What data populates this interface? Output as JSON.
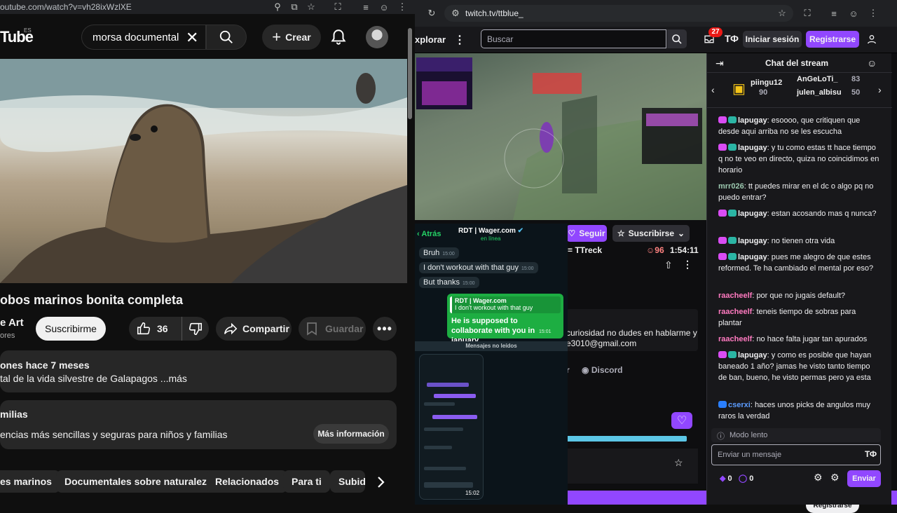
{
  "youtube": {
    "url": "outube.com/watch?v=vh28ixWzlXE",
    "logo": "Tube",
    "logo_region": "ES",
    "search_value": "morsa documental",
    "create_label": "Crear",
    "video_title": "obos marinos bonita completa",
    "channel_name": "e Art",
    "channel_subs": "ores",
    "subscribe_label": "Suscribirme",
    "likes": "36",
    "share_label": "Compartir",
    "save_label": "Guardar",
    "desc_meta": "ones  hace 7 meses",
    "desc_text": "tal de la vida silvestre de Galapagos ...más",
    "info_title": "milias",
    "info_text": "encias más sencillas y seguras para niños y familias",
    "info_more": "Más información",
    "chips": [
      "es marinos",
      "Documentales sobre naturaleza",
      "Relacionados",
      "Para ti",
      "Subid"
    ]
  },
  "twitch": {
    "url": "twitch.tv/ttblue_",
    "explore": "xplorar",
    "search_placeholder": "Buscar",
    "notif_count": "27",
    "login_label": "Iniciar sesión",
    "register_label": "Registrarse",
    "follow_label": "Seguir",
    "subscribe_label": "Suscribirse",
    "streamer_tag": "= TTreck",
    "viewers": "96",
    "uptime": "1:54:11",
    "about_line1": "curiosidad no dudes en hablarme y",
    "about_line2": "e3010@gmail.com",
    "discord_label": "Discord",
    "link_r": "r",
    "register_bottom": "Registrarse"
  },
  "whatsapp": {
    "back": "Atrás",
    "contact": "RDT | Wager.com",
    "status": "en línea",
    "messages": [
      {
        "text": "Bruh",
        "time": "15:00"
      },
      {
        "text": "I don't workout with that guy",
        "time": "15:00"
      },
      {
        "text": "But thanks",
        "time": "15:00"
      }
    ],
    "quote_author": "RDT | Wager.com",
    "quote_text": "I don't workout with that guy",
    "reply_text": "He is supposed to collaborate with you in january",
    "reply_time": "15:01",
    "unread_label": "Mensajes no leídos",
    "shot_time": "15:02"
  },
  "chat": {
    "title": "Chat del stream",
    "gifters": [
      {
        "name": "piingu12",
        "count": "90"
      },
      {
        "name": "AnGeLoTi_",
        "count": "83"
      },
      {
        "name": "julen_albisu",
        "count": "50"
      }
    ],
    "messages": [
      {
        "user": "lapugay",
        "text": "esoooo, que critiquen que desde aqui arriba no se les escucha",
        "color": "#d94cf3",
        "badges": true
      },
      {
        "user": "lapugay",
        "text": "y tu como estas tt hace tiempo q no te veo en directo, quiza no coincidimos en horario",
        "color": "#d94cf3",
        "badges": true
      },
      {
        "user": "mrr026",
        "text": "tt puedes mirar en el dc o algo pq no puedo entrar?",
        "color": "#9cc9b0",
        "badges": false
      },
      {
        "user": "lapugay",
        "text": "estan acosando mas q nunca?",
        "color": "#d94cf3",
        "badges": true
      },
      {
        "user": "lapugay",
        "text": "no tienen otra vida",
        "color": "#d94cf3",
        "badges": true
      },
      {
        "user": "lapugay",
        "text": "pues me alegro de que estes reformed. Te ha cambiado el mental por eso?",
        "color": "#d94cf3",
        "badges": true
      },
      {
        "user": "raacheelf",
        "text": "por que no jugais default?",
        "color": "#ff7ac0",
        "badges": false
      },
      {
        "user": "raacheelf",
        "text": "teneis tiempo de sobras para plantar",
        "color": "#ff7ac0",
        "badges": false
      },
      {
        "user": "raacheelf",
        "text": "no hace falta jugar tan apurados",
        "color": "#ff7ac0",
        "badges": false
      },
      {
        "user": "lapugay",
        "text": "y como es posible que hayan baneado 1 año? jamas he visto tanto tiempo de ban, bueno, he visto permas pero ya esta",
        "color": "#d94cf3",
        "badges": true
      },
      {
        "user": "cserxi",
        "text": "haces unos picks de angulos muy raros la verdad",
        "color": "#5c9cff",
        "badges": false
      }
    ],
    "slow_mode": "Modo lento",
    "input_placeholder": "Enviar un mensaje",
    "points_1": "0",
    "points_2": "0",
    "send_label": "Enviar"
  },
  "colors": {
    "twitch_purple": "#9147ff",
    "whatsapp_green": "#1dae42",
    "youtube_bg": "#0f0f0f"
  }
}
